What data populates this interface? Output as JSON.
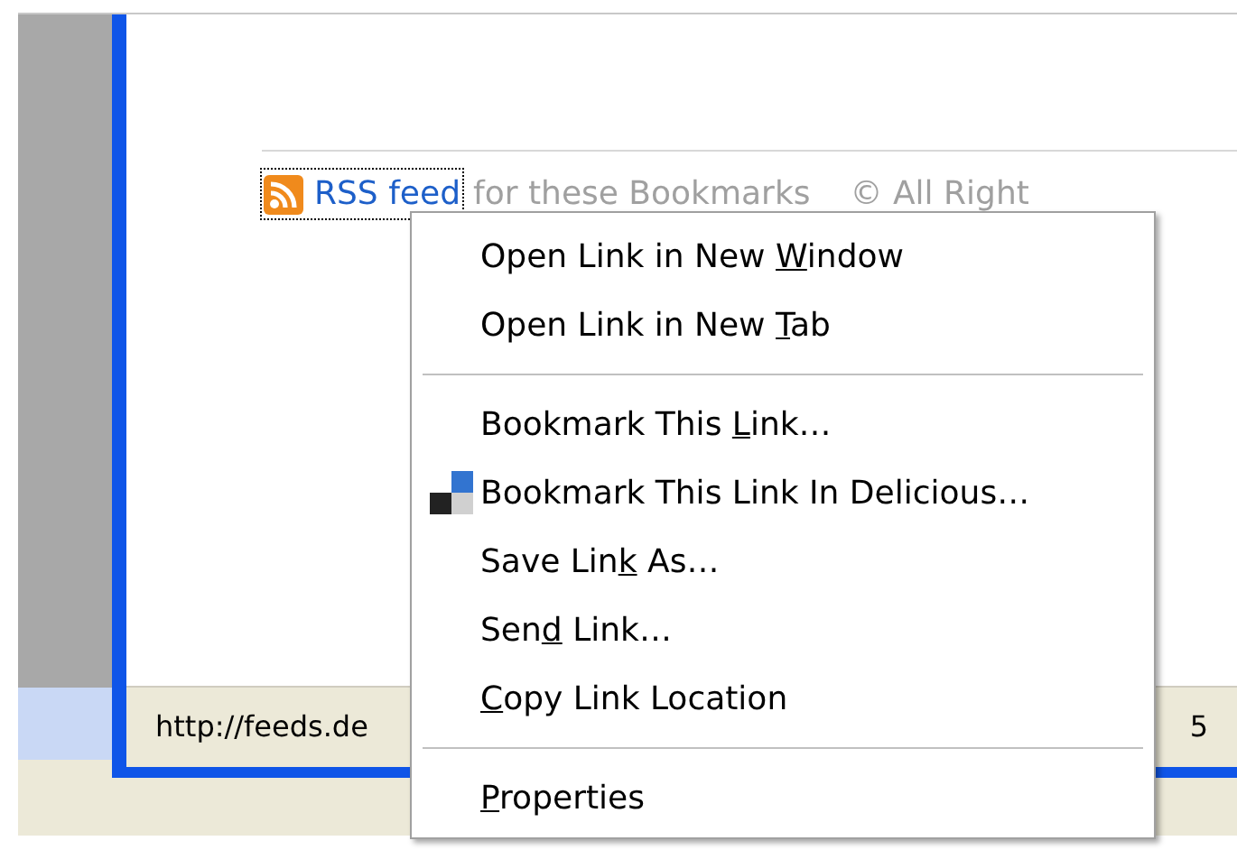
{
  "page": {
    "link": "RSS feed",
    "link_focused": true,
    "trailing_text": "for these Bookmarks",
    "copyright": "© All Right"
  },
  "status_bar": {
    "url": "http://feeds.de",
    "right_text": "5"
  },
  "context_menu": {
    "items": [
      {
        "kind": "item",
        "label_start": "Open Link in New ",
        "access_key": "W",
        "label_end": "indow"
      },
      {
        "kind": "item",
        "label_start": "Open Link in New ",
        "access_key": "T",
        "label_end": "ab"
      },
      {
        "kind": "separator"
      },
      {
        "kind": "item",
        "label_start": "Bookmark This ",
        "access_key": "L",
        "label_end": "ink…"
      },
      {
        "kind": "icon_item",
        "label_start": "Bookmark This Link In Delicious…"
      },
      {
        "kind": "item",
        "label_start": "Save Lin",
        "access_key": "k",
        "label_end": " As…"
      },
      {
        "kind": "item",
        "label_start": "Sen",
        "access_key": "d",
        "label_end": " Link…"
      },
      {
        "kind": "item",
        "access_key": "C",
        "label_end": "opy Link Location"
      },
      {
        "kind": "separator"
      },
      {
        "kind": "item",
        "access_key": "P",
        "label_end": "roperties"
      }
    ]
  }
}
